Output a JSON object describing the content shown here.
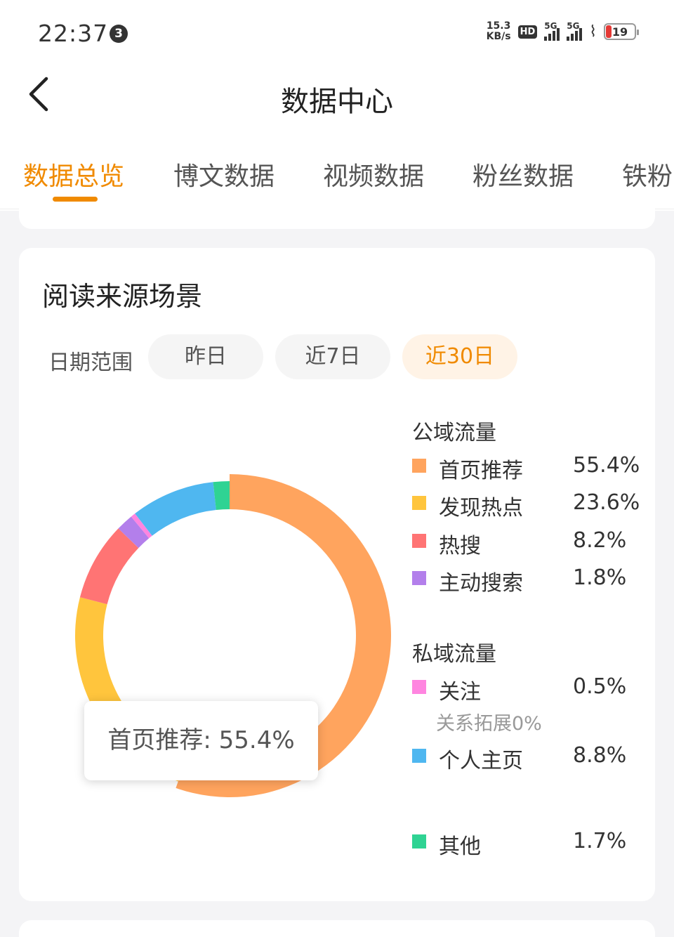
{
  "status_bar": {
    "time": "22:37",
    "notification_count": "3",
    "net_speed_value": "15.3",
    "net_speed_unit": "KB/s",
    "hd_label": "HD",
    "sim1_label": "5G",
    "sim2_label": "5G",
    "battery": "19"
  },
  "header": {
    "title": "数据中心"
  },
  "tabs": [
    {
      "label": "数据总览",
      "active": true
    },
    {
      "label": "博文数据"
    },
    {
      "label": "视频数据"
    },
    {
      "label": "粉丝数据"
    },
    {
      "label": "铁粉"
    }
  ],
  "card": {
    "title": "阅读来源场景",
    "date_range_label": "日期范围",
    "date_options": [
      "昨日",
      "近7日",
      "近30日"
    ],
    "selected_date": "近30日",
    "tooltip": "首页推荐: 55.4%",
    "public_title": "公域流量",
    "private_title": "私域流量",
    "relation_note": "关系拓展0%"
  },
  "colors": {
    "accent": "#f08a00",
    "首页推荐": "#ffa45e",
    "发现热点": "#ffc53d",
    "热搜": "#ff7474",
    "主动搜索": "#b37feb",
    "关注": "#ff85e0",
    "个人主页": "#4fb7f0",
    "其他": "#2fd393"
  },
  "chart_data": {
    "type": "pie",
    "style": "donut",
    "categories": [
      "首页推荐",
      "发现热点",
      "热搜",
      "主动搜索",
      "关注",
      "个人主页",
      "其他"
    ],
    "values": [
      55.4,
      23.6,
      8.2,
      1.8,
      0.5,
      8.8,
      1.7
    ],
    "value_labels": [
      "55.4%",
      "23.6%",
      "8.2%",
      "1.8%",
      "0.5%",
      "8.8%",
      "1.7%"
    ],
    "groups": {
      "公域流量": [
        "首页推荐",
        "发现热点",
        "热搜",
        "主动搜索"
      ],
      "私域流量": [
        "关注",
        "个人主页",
        "其他"
      ]
    },
    "highlighted": "首页推荐"
  }
}
